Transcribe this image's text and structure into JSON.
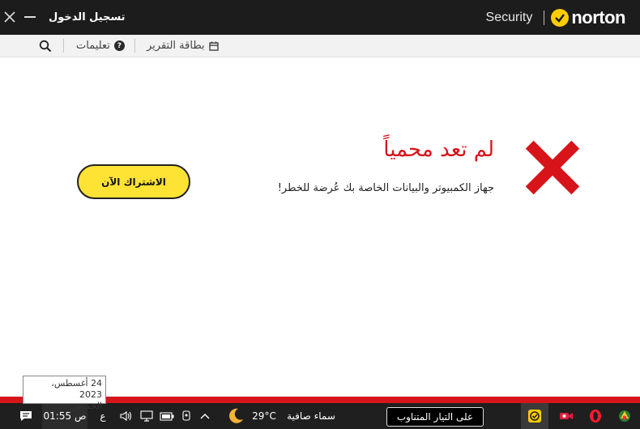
{
  "titlebar": {
    "signin_label": "تسجيل الدخول",
    "product": "Security",
    "brand": "norton"
  },
  "toolbar": {
    "help_label": "تعليمات",
    "report_label": "بطاقة التقرير"
  },
  "status": {
    "headline": "لم تعد محمياً",
    "description": "جهاز الكمبيوتر والبيانات الخاصة بك عُرضة للخطر!",
    "subscribe_label": "الاشتراك الآن",
    "accent_red": "#d7141a",
    "accent_yellow": "#fee335"
  },
  "taskbar": {
    "time": "01:55 ص",
    "lang": "ع",
    "temperature": "29°C",
    "weather": "سماء صافية",
    "current_btn": "على التيار المتناوب",
    "tooltip_date": "24 أغسطس، 2023",
    "tooltip_day": "الخميس"
  }
}
